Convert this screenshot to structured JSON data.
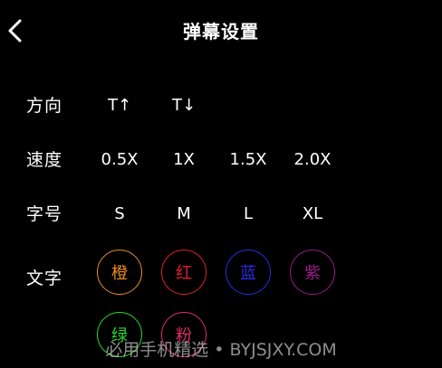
{
  "header": {
    "title": "弹幕设置",
    "back_icon": "chevron-left-icon"
  },
  "direction": {
    "label": "方向",
    "options": [
      "T↑",
      "T↓"
    ]
  },
  "speed": {
    "label": "速度",
    "options": [
      "0.5X",
      "1X",
      "1.5X",
      "2.0X"
    ]
  },
  "font_size": {
    "label": "字号",
    "options": [
      "S",
      "M",
      "L",
      "XL"
    ]
  },
  "text_color": {
    "label": "文字",
    "colors": [
      {
        "label": "橙",
        "color": "#f08a24"
      },
      {
        "label": "红",
        "color": "#e0202a"
      },
      {
        "label": "蓝",
        "color": "#2a2ae8"
      },
      {
        "label": "紫",
        "color": "#9a1a8c"
      },
      {
        "label": "绿",
        "color": "#2ad82a"
      },
      {
        "label": "粉",
        "color": "#e0306a"
      }
    ]
  },
  "watermark": "必用手机精选 • BYJSJXY.COM"
}
